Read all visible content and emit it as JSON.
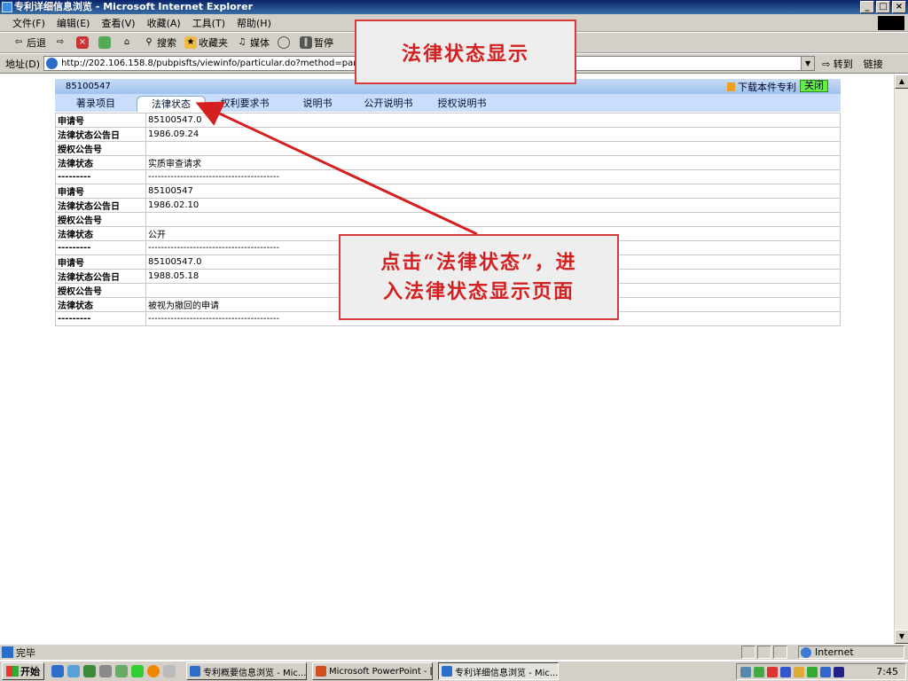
{
  "window": {
    "title": "专利详细信息浏览 - Microsoft Internet Explorer"
  },
  "menu": [
    "文件(F)",
    "编辑(E)",
    "查看(V)",
    "收藏(A)",
    "工具(T)",
    "帮助(H)"
  ],
  "toolbar": {
    "back": "后退",
    "search": "搜索",
    "favorites": "收藏夹",
    "media": "媒体",
    "pause": "暂停"
  },
  "address": {
    "label": "地址(D)",
    "url": "http://202.106.158.8/pubpisfts/viewinfo/particular.do?method=partizlxm&inc",
    "go": "转到",
    "links": "链接"
  },
  "patent": {
    "number": "85100547",
    "download": "下载本件专利",
    "close": "关闭"
  },
  "tabs": [
    {
      "label": "著录项目"
    },
    {
      "label": "法律状态"
    },
    {
      "label": "权利要求书"
    },
    {
      "label": "说明书"
    },
    {
      "label": "公开说明书"
    },
    {
      "label": "授权说明书"
    }
  ],
  "rows": [
    {
      "label": "申请号",
      "value": "85100547.0"
    },
    {
      "label": "法律状态公告日",
      "value": "1986.09.24"
    },
    {
      "label": "授权公告号",
      "value": ""
    },
    {
      "label": "法律状态",
      "value": "实质审查请求"
    },
    {
      "label": "---------",
      "value": "-----------------------------------------"
    },
    {
      "label": "申请号",
      "value": "85100547"
    },
    {
      "label": "法律状态公告日",
      "value": "1986.02.10"
    },
    {
      "label": "授权公告号",
      "value": ""
    },
    {
      "label": "法律状态",
      "value": "公开"
    },
    {
      "label": "---------",
      "value": "-----------------------------------------"
    },
    {
      "label": "申请号",
      "value": "85100547.0"
    },
    {
      "label": "法律状态公告日",
      "value": "1988.05.18"
    },
    {
      "label": "授权公告号",
      "value": ""
    },
    {
      "label": "法律状态",
      "value": "被视为撤回的申请"
    },
    {
      "label": "---------",
      "value": "-----------------------------------------"
    }
  ],
  "annotations": {
    "top": "法律状态显示",
    "middle_line1": "点击“法律状态”，进",
    "middle_line2": "入法律状态显示页面"
  },
  "statusbar": {
    "text": "完毕",
    "zone": "Internet"
  },
  "taskbar": {
    "start": "开始",
    "tasks": [
      {
        "label": "专利概要信息浏览 - Mic..."
      },
      {
        "label": "Microsoft PowerPoint - [..."
      },
      {
        "label": "专利详细信息浏览 - Mic..."
      }
    ],
    "clock": "7:45"
  },
  "colors": {
    "annotation_red": "#d42020",
    "tab_bar": "#c9defa",
    "close_green": "#66ee44"
  }
}
